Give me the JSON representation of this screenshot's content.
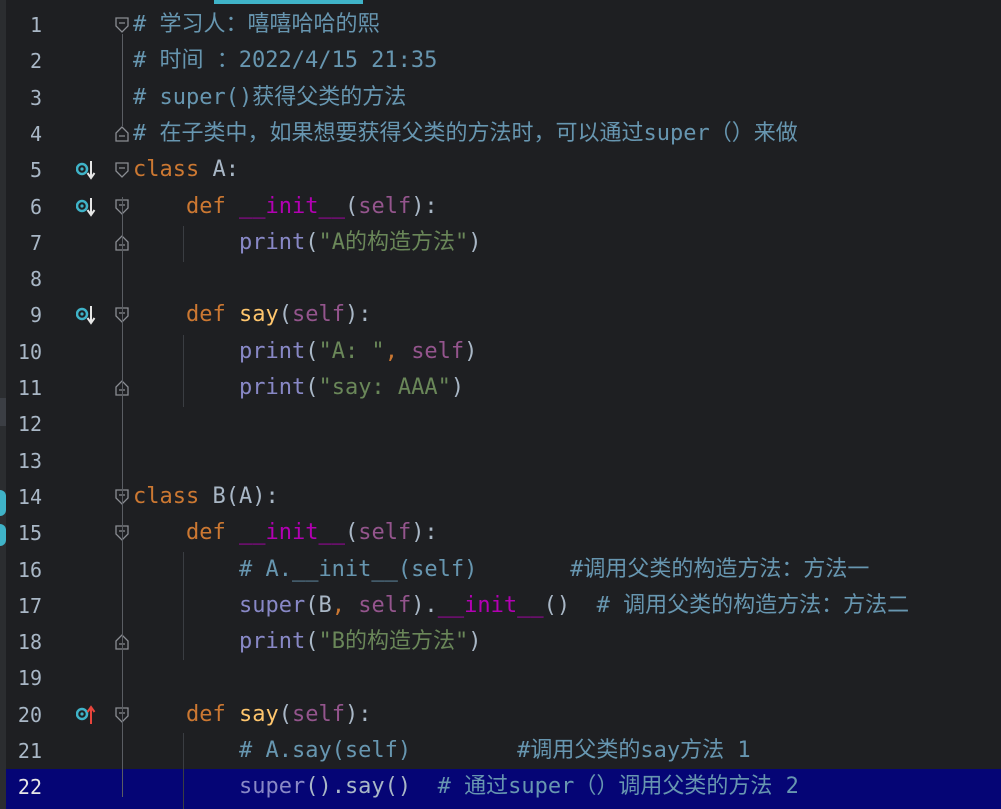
{
  "editor": {
    "language": "python",
    "current_line": 22,
    "colors": {
      "background": "#1e1f22",
      "current_line": "#050575",
      "keyword": "#cc7832",
      "function": "#ffc66d",
      "string": "#6a8759",
      "comment": "#6796b0",
      "self": "#94558d",
      "builtin": "#8888c6",
      "magic": "#b200b2",
      "line_number": "#a9b7c6",
      "gutter_icon": "#3fb3c8",
      "override_arrow": "#e8453c"
    },
    "lines": [
      {
        "num": "1",
        "segs": [
          {
            "t": "# 学习人：嘻嘻哈哈的熙",
            "c": "c"
          }
        ]
      },
      {
        "num": "2",
        "segs": [
          {
            "t": "# 时间 ：2022/4/15 21:35",
            "c": "c"
          }
        ]
      },
      {
        "num": "3",
        "segs": [
          {
            "t": "# super()获得父类的方法",
            "c": "c"
          }
        ]
      },
      {
        "num": "4",
        "segs": [
          {
            "t": "# 在子类中，如果想要获得父类的方法时，可以通过super（）来做",
            "c": "c"
          }
        ]
      },
      {
        "num": "5",
        "segs": [
          {
            "t": "class",
            "c": "k"
          },
          {
            "t": " A:",
            "c": ""
          }
        ]
      },
      {
        "num": "6",
        "segs": [
          {
            "t": "    ",
            "c": ""
          },
          {
            "t": "def",
            "c": "k"
          },
          {
            "t": " ",
            "c": ""
          },
          {
            "t": "__init__",
            "c": "m"
          },
          {
            "t": "(",
            "c": ""
          },
          {
            "t": "self",
            "c": "p"
          },
          {
            "t": "):",
            "c": ""
          }
        ]
      },
      {
        "num": "7",
        "segs": [
          {
            "t": "        ",
            "c": ""
          },
          {
            "t": "print",
            "c": "b"
          },
          {
            "t": "(",
            "c": ""
          },
          {
            "t": "\"A的构造方法\"",
            "c": "s"
          },
          {
            "t": ")",
            "c": ""
          }
        ]
      },
      {
        "num": "8",
        "segs": []
      },
      {
        "num": "9",
        "segs": [
          {
            "t": "    ",
            "c": ""
          },
          {
            "t": "def",
            "c": "k"
          },
          {
            "t": " ",
            "c": ""
          },
          {
            "t": "say",
            "c": "f"
          },
          {
            "t": "(",
            "c": ""
          },
          {
            "t": "self",
            "c": "p"
          },
          {
            "t": "):",
            "c": ""
          }
        ]
      },
      {
        "num": "10",
        "segs": [
          {
            "t": "        ",
            "c": ""
          },
          {
            "t": "print",
            "c": "b"
          },
          {
            "t": "(",
            "c": ""
          },
          {
            "t": "\"A: \"",
            "c": "s"
          },
          {
            "t": ", ",
            "c": "k"
          },
          {
            "t": "self",
            "c": "p"
          },
          {
            "t": ")",
            "c": ""
          }
        ]
      },
      {
        "num": "11",
        "segs": [
          {
            "t": "        ",
            "c": ""
          },
          {
            "t": "print",
            "c": "b"
          },
          {
            "t": "(",
            "c": ""
          },
          {
            "t": "\"say: AAA\"",
            "c": "s"
          },
          {
            "t": ")",
            "c": ""
          }
        ]
      },
      {
        "num": "12",
        "segs": []
      },
      {
        "num": "13",
        "segs": []
      },
      {
        "num": "14",
        "segs": [
          {
            "t": "class",
            "c": "k"
          },
          {
            "t": " B(A):",
            "c": ""
          }
        ]
      },
      {
        "num": "15",
        "segs": [
          {
            "t": "    ",
            "c": ""
          },
          {
            "t": "def",
            "c": "k"
          },
          {
            "t": " ",
            "c": ""
          },
          {
            "t": "__init__",
            "c": "m"
          },
          {
            "t": "(",
            "c": ""
          },
          {
            "t": "self",
            "c": "p"
          },
          {
            "t": "):",
            "c": ""
          }
        ]
      },
      {
        "num": "16",
        "segs": [
          {
            "t": "        ",
            "c": ""
          },
          {
            "t": "# A.__init__(self)       #调用父类的构造方法：方法一",
            "c": "c"
          }
        ]
      },
      {
        "num": "17",
        "segs": [
          {
            "t": "        ",
            "c": ""
          },
          {
            "t": "super",
            "c": "b"
          },
          {
            "t": "(B",
            "c": ""
          },
          {
            "t": ", ",
            "c": "k"
          },
          {
            "t": "self",
            "c": "p"
          },
          {
            "t": ").",
            "c": ""
          },
          {
            "t": "__init__",
            "c": "m"
          },
          {
            "t": "()  ",
            "c": ""
          },
          {
            "t": "# 调用父类的构造方法：方法二",
            "c": "c"
          }
        ]
      },
      {
        "num": "18",
        "segs": [
          {
            "t": "        ",
            "c": ""
          },
          {
            "t": "print",
            "c": "b"
          },
          {
            "t": "(",
            "c": ""
          },
          {
            "t": "\"B的构造方法\"",
            "c": "s"
          },
          {
            "t": ")",
            "c": ""
          }
        ]
      },
      {
        "num": "19",
        "segs": []
      },
      {
        "num": "20",
        "segs": [
          {
            "t": "    ",
            "c": ""
          },
          {
            "t": "def",
            "c": "k"
          },
          {
            "t": " ",
            "c": ""
          },
          {
            "t": "say",
            "c": "f"
          },
          {
            "t": "(",
            "c": ""
          },
          {
            "t": "self",
            "c": "p"
          },
          {
            "t": "):",
            "c": ""
          }
        ]
      },
      {
        "num": "21",
        "segs": [
          {
            "t": "        ",
            "c": ""
          },
          {
            "t": "# A.say(self)        #调用父类的say方法 1",
            "c": "c"
          }
        ]
      },
      {
        "num": "22",
        "segs": [
          {
            "t": "        ",
            "c": ""
          },
          {
            "t": "super",
            "c": "b"
          },
          {
            "t": "().say()  ",
            "c": ""
          },
          {
            "t": "# 通过super（）调用父类的方法 2",
            "c": "c"
          }
        ]
      }
    ],
    "gutter_icons": {
      "5": "overridden-down-icon",
      "6": "overridden-down-icon",
      "9": "overridden-down-icon",
      "20": "override-up-icon"
    },
    "fold_markers": {
      "1": "fold-open-icon",
      "4": "fold-end-icon",
      "5": "fold-open-icon",
      "6": "fold-open-icon",
      "7": "fold-end-icon",
      "9": "fold-open-icon",
      "11": "fold-end-icon",
      "14": "fold-open-icon",
      "15": "fold-open-icon",
      "18": "fold-end-icon",
      "20": "fold-open-icon"
    }
  }
}
